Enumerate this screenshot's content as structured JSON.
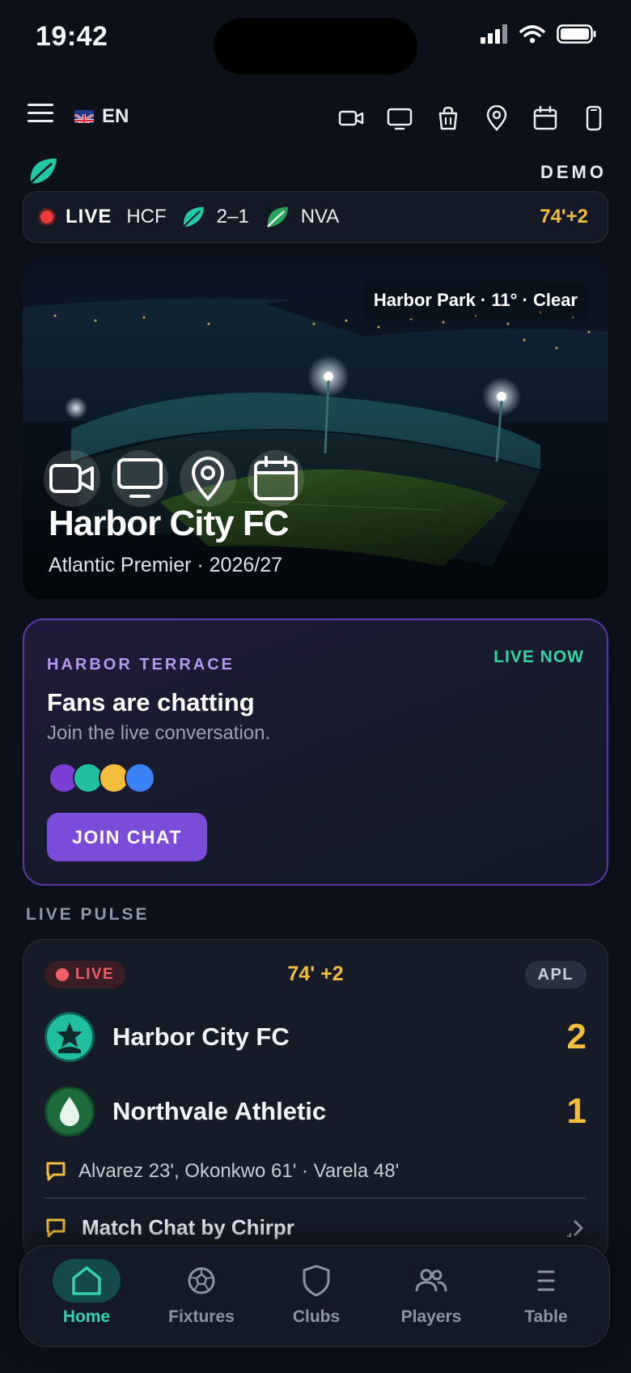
{
  "status_bar": {
    "time": "19:42"
  },
  "toolbar": {
    "language": "EN",
    "icons": [
      "video-icon",
      "monitor-icon",
      "shopping-bag-icon",
      "location-pin-icon",
      "calendar-icon",
      "phone-icon"
    ]
  },
  "brand": {
    "demo_label": "DEMO"
  },
  "ticker": {
    "live_label": "LIVE",
    "home_team": "HCF",
    "score": "2–1",
    "away_team": "NVA",
    "clock": "74'+2"
  },
  "hero": {
    "weather": "Harbor Park · 11° · Clear",
    "title": "Harbor City FC",
    "subtitle": "Atlantic Premier · 2026/27",
    "icons": [
      "video-icon",
      "monitor-icon",
      "location-pin-icon",
      "calendar-icon"
    ]
  },
  "chat_card": {
    "eyebrow": "HARBOR TERRACE",
    "live_now": "LIVE NOW",
    "title": "Fans are chatting",
    "subtitle": "Join the live conversation.",
    "avatar_colors": [
      "#7b3fd6",
      "#1fbf9f",
      "#f3be3c",
      "#3b82f6"
    ],
    "join_label": "JOIN CHAT"
  },
  "live_pulse": {
    "section_label": "LIVE PULSE",
    "live_label": "LIVE",
    "clock": "74' +2",
    "league": "APL",
    "home": {
      "name": "Harbor City FC",
      "score": "2"
    },
    "away": {
      "name": "Northvale Athletic",
      "score": "1"
    },
    "goals": "Alvarez 23', Okonkwo 61' · Varela 48'",
    "match_chat": "Match Chat by Chirpr"
  },
  "nav": {
    "items": [
      {
        "label": "Home",
        "icon": "home-icon",
        "active": true
      },
      {
        "label": "Fixtures",
        "icon": "ball-icon",
        "active": false
      },
      {
        "label": "Clubs",
        "icon": "shield-icon",
        "active": false
      },
      {
        "label": "Players",
        "icon": "users-icon",
        "active": false
      },
      {
        "label": "Table",
        "icon": "list-icon",
        "active": false
      }
    ]
  },
  "colors": {
    "accent_teal": "#33d1ad",
    "score_yellow": "#f3be3c",
    "live_red": "#ef3b3b",
    "chat_purple": "#7b4bd9"
  }
}
